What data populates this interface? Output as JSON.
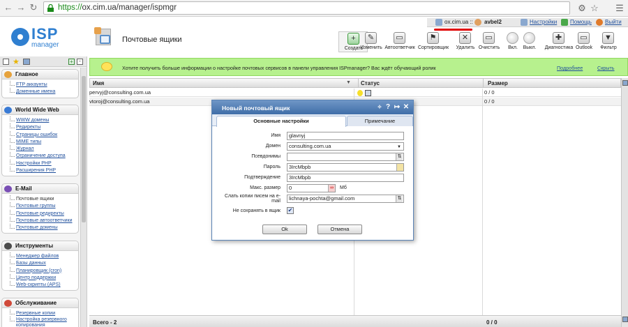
{
  "browser": {
    "url_protocol": "https://",
    "url_rest": "ox.cim.ua/manager/ispmgr",
    "back_icon": "arrow-left-icon",
    "forward_icon": "arrow-right-icon",
    "reload_icon": "reload-icon"
  },
  "logo": {
    "name": "ISP",
    "subtitle": "manager"
  },
  "page": {
    "title": "Почтовые ящики"
  },
  "userbar": {
    "server": "ox.cim.ua ::",
    "user": "avbel2",
    "settings": "Настройки",
    "help": "Помощь",
    "logout": "Выйти"
  },
  "toolbar": [
    {
      "label": "Создать",
      "icon": "mailbox-add-icon",
      "glyph": "+"
    },
    {
      "label": "Изменить",
      "icon": "edit-icon",
      "glyph": "✎"
    },
    {
      "label": "Автоответчик",
      "icon": "autoresponder-icon",
      "glyph": "▭"
    },
    {
      "label": "Сортировщик",
      "icon": "sorter-icon",
      "glyph": "⚑"
    },
    {
      "label": "Удалить",
      "icon": "delete-icon",
      "glyph": "✕"
    },
    {
      "label": "Очистить",
      "icon": "clear-icon",
      "glyph": "▭"
    },
    {
      "label": "Вкл.",
      "icon": "bulb-on-icon",
      "glyph": ""
    },
    {
      "label": "Выкл.",
      "icon": "bulb-off-icon",
      "glyph": ""
    },
    {
      "label": "Диагностика",
      "icon": "diagnostics-icon",
      "glyph": "✚"
    },
    {
      "label": "Outlook",
      "icon": "outlook-icon",
      "glyph": "▭"
    },
    {
      "label": "Фильтр",
      "icon": "filter-icon",
      "glyph": "▼"
    }
  ],
  "sidebar": {
    "groups": [
      {
        "title": "Главное",
        "color": "#e6a23c",
        "items": [
          "FTP аккаунты",
          "Доменные имена"
        ]
      },
      {
        "title": "World Wide Web",
        "color": "#3a7bd5",
        "items": [
          "WWW домены",
          "Редиректы",
          "Страницы ошибок",
          "MIME типы",
          "Журнал",
          "Ограничение доступа",
          "Настройки PHP",
          "Расширения PHP"
        ]
      },
      {
        "title": "E-Mail",
        "color": "#7a4fb5",
        "items": [
          "Почтовые ящики",
          "Почтовые группы",
          "Почтовые редиректы",
          "Почтовые автоответчики",
          "Почтовые домены"
        ]
      },
      {
        "title": "Инструменты",
        "color": "#4b4b4b",
        "items": [
          "Менеджер файлов",
          "Базы данных",
          "Планировщик (cron)",
          "Центр поддержки",
          "Web-скрипты (APS)"
        ]
      },
      {
        "title": "Обслуживание",
        "color": "#d04a3a",
        "items": [
          "Резервные копии",
          "Настройка резервного копирования"
        ]
      }
    ]
  },
  "banner": {
    "text": "Хотите получить больше информации о настройке почтовых сервисов в панели управления ISPmanager? Вас ждёт обучающий ролик",
    "more": "Подробнее",
    "hide": "Скрыть"
  },
  "table": {
    "columns": [
      "Имя",
      "Статус",
      "Размер"
    ],
    "rows": [
      {
        "name": "pervyj@consulting.com.ua",
        "size": "0 / 0"
      },
      {
        "name": "vtoroj@consulting.com.ua",
        "size": "0 / 0"
      }
    ],
    "footer_total": "Всего - 2",
    "footer_size": "0 / 0"
  },
  "dialog": {
    "title": "Новый почтовый ящик",
    "tab_main": "Основные настройки",
    "tab_note": "Примечание",
    "fields": {
      "name_label": "Имя",
      "name_value": "glavnyj",
      "domain_label": "Домен",
      "domain_value": "consulting.com.ua",
      "aliases_label": "Псевдонимы",
      "aliases_value": "",
      "password_label": "Пароль",
      "password_value": "3IrcMbpb",
      "confirm_label": "Подтверждение",
      "confirm_value": "3IrcMbpb",
      "maxsize_label": "Макс. размер",
      "maxsize_value": "0",
      "maxsize_unit": "Мб",
      "copy_label_1": "Слать копии писем на e-",
      "copy_label_2": "mail",
      "copy_value": "lichnaya-pochta@gmail.com",
      "nosave_label": "Не сохранять в ящик",
      "nosave_checked": "✔"
    },
    "ok": "Ok",
    "cancel": "Отмена"
  }
}
